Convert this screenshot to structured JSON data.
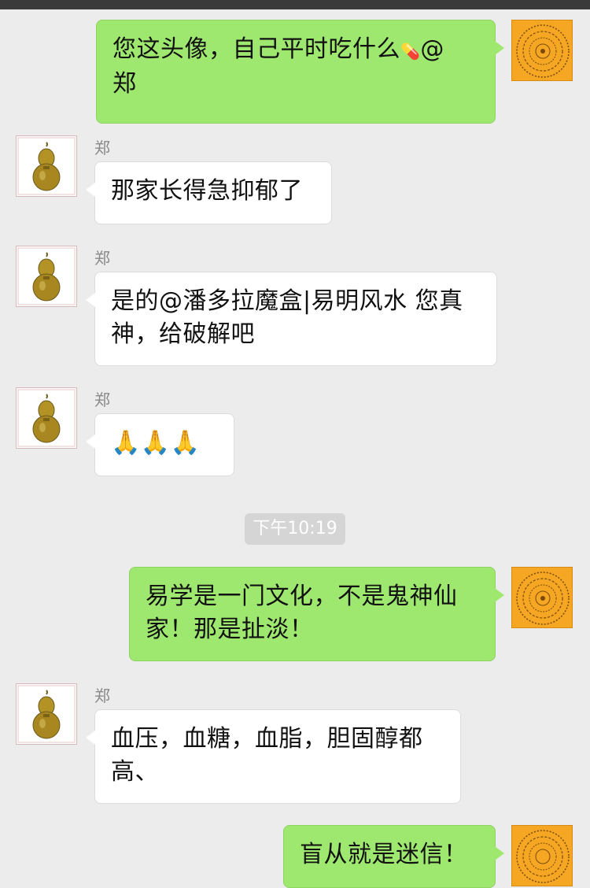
{
  "messages": [
    {
      "id": "m1",
      "direction": "out",
      "text_parts": [
        "您这头像，自己平时吃什么",
        "@",
        "郑"
      ],
      "icon": "pill-icon"
    },
    {
      "id": "m2",
      "direction": "in",
      "sender": "郑",
      "text": "那家长得急抑郁了"
    },
    {
      "id": "m3",
      "direction": "in",
      "sender": "郑",
      "text_lines": [
        "是的@潘多拉魔盒|易明风水 您真",
        "神，给破解吧"
      ]
    },
    {
      "id": "m4",
      "direction": "in",
      "sender": "郑",
      "emoji": "🙏🙏🙏",
      "icon": "praying-hands-icon"
    },
    {
      "id": "m5",
      "direction": "out",
      "text_lines": [
        "易学是一门文化，不是鬼神仙",
        "家！那是扯淡！"
      ]
    },
    {
      "id": "m6",
      "direction": "in",
      "sender": "郑",
      "text_lines": [
        "血压，血糖，血脂，胆固醇都",
        "高、"
      ]
    },
    {
      "id": "m7",
      "direction": "out",
      "text": "盲从就是迷信！"
    }
  ],
  "timestamp": "下午10:19",
  "avatars": {
    "me_icon": "bagua-compass-avatar-icon",
    "other_icon": "gourd-avatar-icon"
  },
  "colors": {
    "background": "#ececec",
    "bubble_out": "#9fe870",
    "bubble_in": "#ffffff",
    "avatar_me": "#f5a623"
  }
}
